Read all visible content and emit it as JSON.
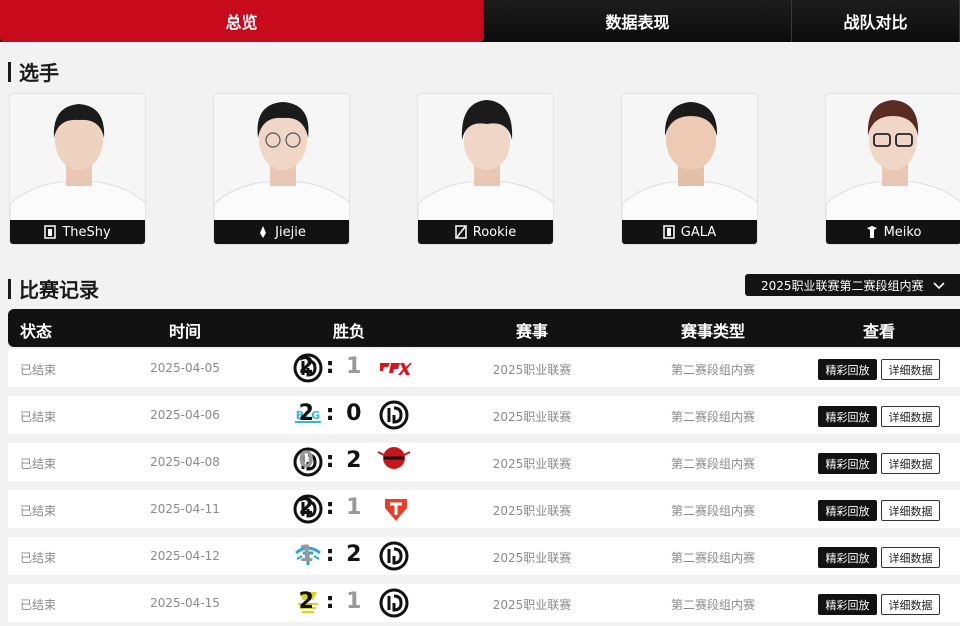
{
  "tabs": [
    {
      "label": "总览",
      "active": true
    },
    {
      "label": "数据表现",
      "active": false
    },
    {
      "label": "战队对比",
      "active": false
    }
  ],
  "players_title": "选手",
  "players": [
    {
      "name": "TheShy"
    },
    {
      "name": "Jiejie"
    },
    {
      "name": "Rookie"
    },
    {
      "name": "GALA"
    },
    {
      "name": "Meiko"
    }
  ],
  "records_title": "比赛记录",
  "filter": {
    "selected": "2025职业联赛第二赛段组内赛"
  },
  "table": {
    "headers": [
      "状态",
      "时间",
      "胜负",
      "赛事",
      "赛事类型",
      "查看"
    ],
    "rows": [
      {
        "status": "已结束",
        "date": "2025-04-05",
        "score_left": "2",
        "score_right": "1",
        "left_logo": "ig-logo",
        "right_logo": "fpx-logo",
        "event": "2025职业联赛",
        "type": "第二赛段组内赛",
        "replay": "精彩回放",
        "details": "详细数据"
      },
      {
        "status": "已结束",
        "date": "2025-04-06",
        "score_left": "2",
        "score_right": "0",
        "left_logo": "blg-logo",
        "right_logo": "ig-logo",
        "event": "2025职业联赛",
        "type": "第二赛段组内赛",
        "replay": "精彩回放",
        "details": "详细数据"
      },
      {
        "status": "已结束",
        "date": "2025-04-08",
        "score_left": "0",
        "score_right": "2",
        "left_logo": "ig-logo",
        "right_logo": "ninjas-logo",
        "event": "2025职业联赛",
        "type": "第二赛段组内赛",
        "replay": "精彩回放",
        "details": "详细数据"
      },
      {
        "status": "已结束",
        "date": "2025-04-11",
        "score_left": "2",
        "score_right": "1",
        "left_logo": "ig-logo",
        "right_logo": "tes-logo",
        "event": "2025职业联赛",
        "type": "第二赛段组内赛",
        "replay": "精彩回放",
        "details": "详细数据"
      },
      {
        "status": "已结束",
        "date": "2025-04-12",
        "score_left": "1",
        "score_right": "2",
        "left_logo": "tt-logo",
        "right_logo": "ig-logo",
        "event": "2025职业联赛",
        "type": "第二赛段组内赛",
        "replay": "精彩回放",
        "details": "详细数据"
      },
      {
        "status": "已结束",
        "date": "2025-04-15",
        "score_left": "2",
        "score_right": "1",
        "left_logo": "up-logo",
        "right_logo": "ig-logo",
        "event": "2025职业联赛",
        "type": "第二赛段组内赛",
        "replay": "精彩回放",
        "details": "详细数据"
      }
    ]
  },
  "colors": {
    "accent": "#c80b1c",
    "dark": "#121212",
    "background": "#f2f2f2"
  }
}
